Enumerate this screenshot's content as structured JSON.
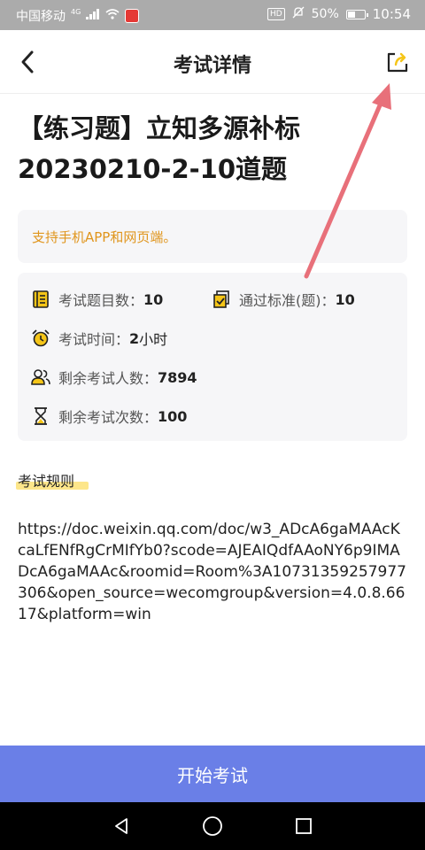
{
  "status_bar": {
    "carrier": "中国移动",
    "network": "4G",
    "hd": "HD",
    "battery": "50%",
    "battery_level": 0.5,
    "time": "10:54"
  },
  "header": {
    "title": "考试详情"
  },
  "exam": {
    "title": "【练习题】立知多源补标20230210-2-10道题",
    "notice": "支持手机APP和网页端。",
    "question_count_label": "考试题目数：",
    "question_count": "10",
    "pass_standard_label": "通过标准(题)：",
    "pass_standard": "10",
    "duration_label": "考试时间：",
    "duration_value": "2",
    "duration_unit": "小时",
    "remaining_people_label": "剩余考试人数：",
    "remaining_people": "7894",
    "remaining_attempts_label": "剩余考试次数：",
    "remaining_attempts": "100"
  },
  "rules": {
    "label": "考试规则",
    "text": "https://doc.weixin.qq.com/doc/w3_ADcA6gaMAAcKcaLfENfRgCrMIfYb0?scode=AJEAIQdfAAoNY6p9IMADcA6gaMAAc&roomid=Room%3A10731359257977306&open_source=wecomgroup&version=4.0.8.6617&platform=win"
  },
  "actions": {
    "start_label": "开始考试"
  },
  "colors": {
    "accent": "#6a7fe7",
    "notice": "#e0951c",
    "icon_yellow": "#f5c518",
    "annotation_arrow": "#e8707a"
  },
  "icons": [
    "back-arrow",
    "share-export",
    "document-list",
    "checklist",
    "alarm-clock",
    "people",
    "hourglass",
    "nav-back",
    "nav-home",
    "nav-recent"
  ]
}
